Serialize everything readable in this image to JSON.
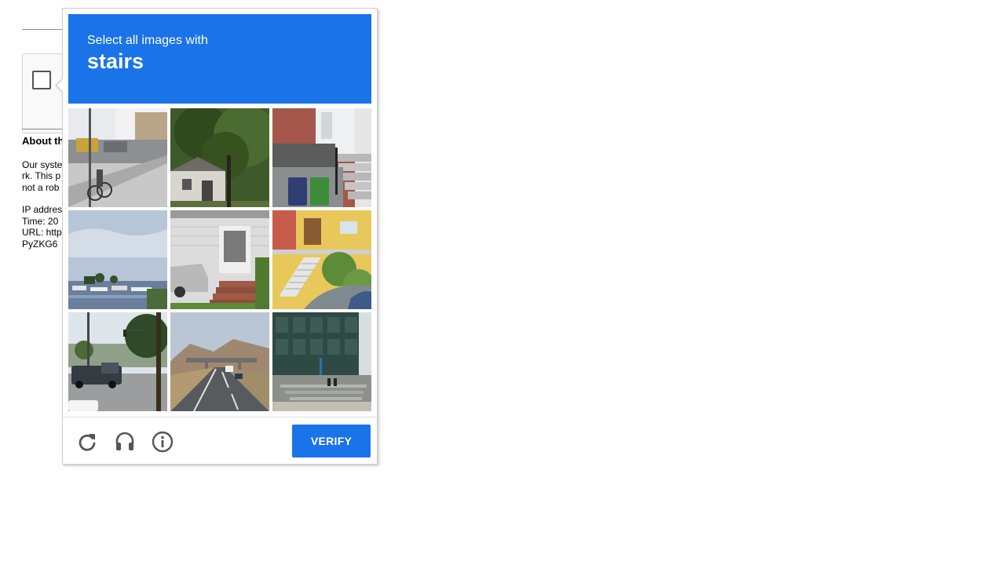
{
  "page": {
    "about_heading": "About th",
    "para1_lines": [
      "Our syste",
      "rk. This p",
      "not a rob"
    ],
    "para2_lines": [
      "IP addres",
      "Time: 20",
      "URL: http",
      "PyZKG6"
    ]
  },
  "challenge": {
    "instruction": "Select all images with",
    "target": "stairs",
    "tiles": [
      {
        "scene": "street with cyclist and parked cars",
        "selected": false
      },
      {
        "scene": "house behind large tree",
        "selected": false
      },
      {
        "scene": "brick stairs with trash bins",
        "selected": false
      },
      {
        "scene": "marina with boats",
        "selected": false
      },
      {
        "scene": "house porch stairs with car",
        "selected": false
      },
      {
        "scene": "yellow building with outdoor stairs",
        "selected": false
      },
      {
        "scene": "intersection with pickup truck",
        "selected": false
      },
      {
        "scene": "highway with overpass",
        "selected": false
      },
      {
        "scene": "building with concrete steps",
        "selected": false
      }
    ],
    "tools": {
      "reload_icon": "reload-icon",
      "audio_icon": "headphones-icon",
      "info_icon": "info-icon"
    },
    "verify_label": "VERIFY"
  },
  "colors": {
    "accent": "#1a73e8",
    "icon": "#555555"
  }
}
